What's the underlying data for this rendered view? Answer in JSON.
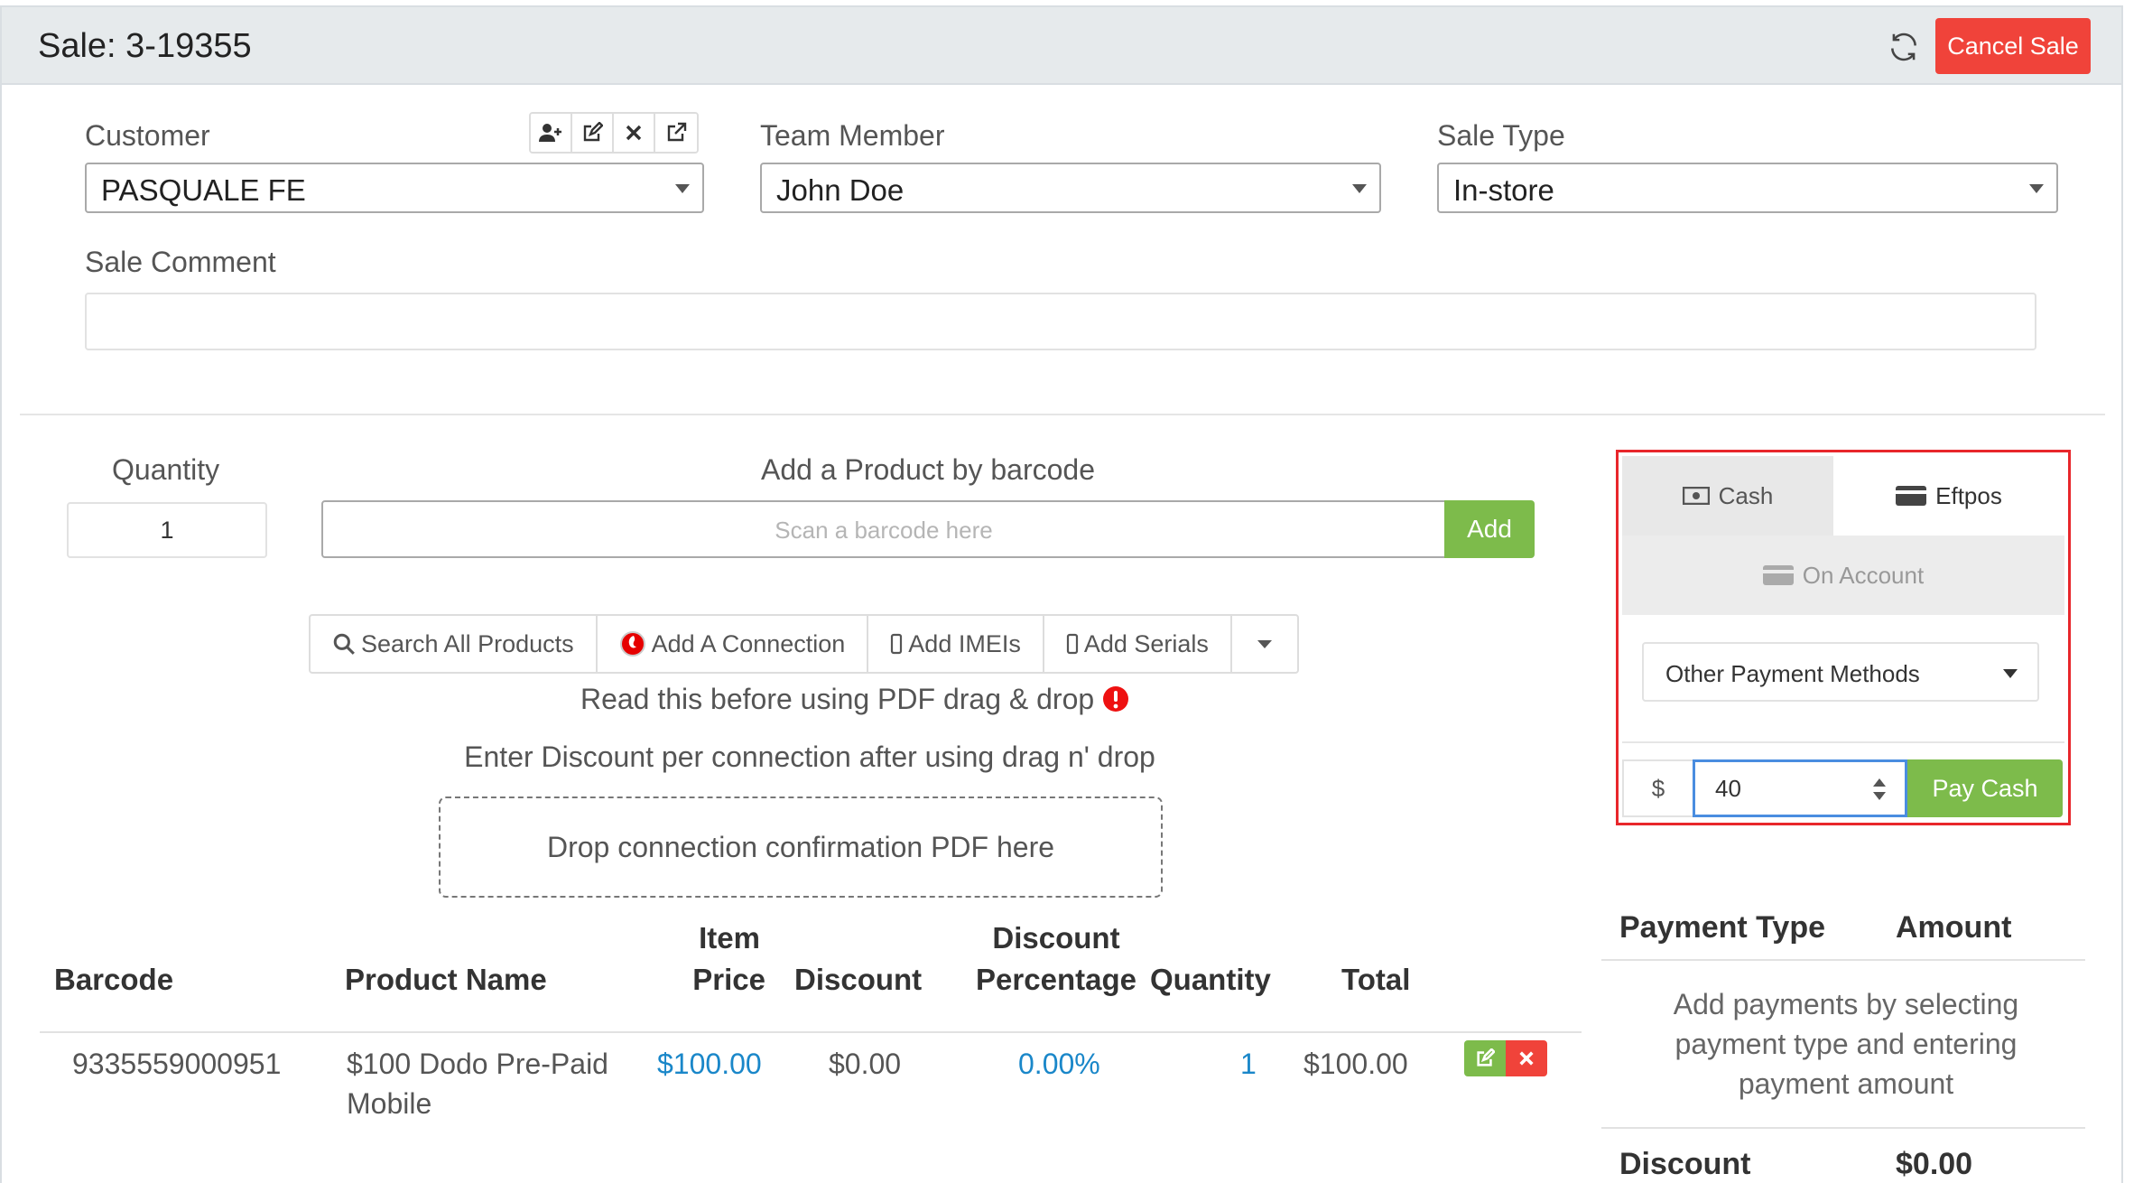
{
  "header": {
    "title": "Sale: 3-19355",
    "cancel_label": "Cancel Sale"
  },
  "form": {
    "customer_label": "Customer",
    "customer_value": "PASQUALE FE",
    "team_label": "Team Member",
    "team_value": "John Doe",
    "saletype_label": "Sale Type",
    "saletype_value": "In-store",
    "comment_label": "Sale Comment",
    "comment_value": ""
  },
  "product": {
    "quantity_label": "Quantity",
    "quantity_value": "1",
    "barcode_label": "Add a Product by barcode",
    "barcode_placeholder": "Scan a barcode here",
    "add_label": "Add",
    "search_all": "Search All Products",
    "add_connection": "Add A Connection",
    "add_imeis": "Add IMEIs",
    "add_serials": "Add Serials",
    "pdf_note": "Read this before using PDF drag & drop",
    "discount_note": "Enter Discount per connection after using drag n' drop",
    "dropzone": "Drop connection confirmation PDF here"
  },
  "table": {
    "headers": {
      "barcode": "Barcode",
      "product_name": "Product Name",
      "item_price_1": "Item",
      "item_price_2": "Price",
      "discount": "Discount",
      "discount_pct_1": "Discount",
      "discount_pct_2": "Percentage",
      "quantity": "Quantity",
      "total": "Total"
    },
    "rows": [
      {
        "barcode": "9335559000951",
        "name_1": "$100 Dodo Pre-Paid",
        "name_2": "Mobile",
        "price": "$100.00",
        "discount": "$0.00",
        "discount_pct": "0.00%",
        "quantity": "1",
        "total": "$100.00"
      }
    ]
  },
  "payment": {
    "tab_cash": "Cash",
    "tab_eftpos": "Eftpos",
    "tab_account": "On Account",
    "other_methods": "Other Payment Methods",
    "currency": "$",
    "amount": "40",
    "pay_label": "Pay Cash",
    "type_header": "Payment Type",
    "amount_header": "Amount",
    "hint": "Add payments by selecting payment type and entering payment amount",
    "discount_label": "Discount",
    "discount_value": "$0.00"
  },
  "colors": {
    "accent_red": "#f0433a",
    "accent_green": "#7dbb4b",
    "link_blue": "#1a87c9",
    "highlight_box": "#e8262b"
  }
}
